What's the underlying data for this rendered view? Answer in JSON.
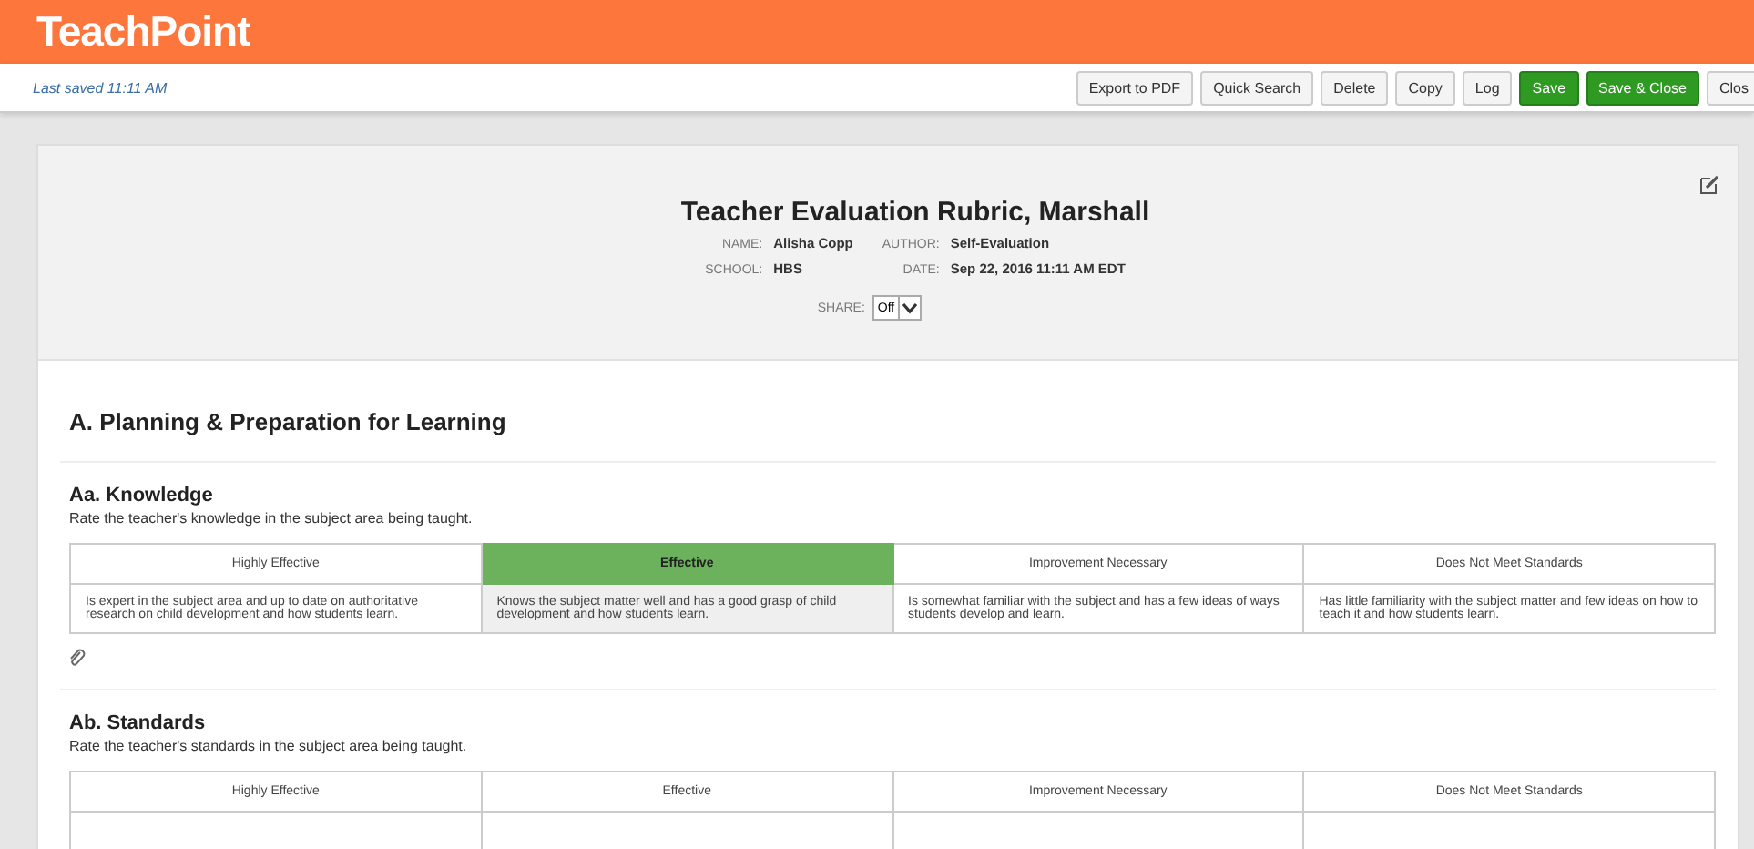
{
  "app": {
    "logo": "TeachPoint"
  },
  "toolbar": {
    "status": "Last saved 11:11 AM",
    "buttons": [
      {
        "label": "Export to PDF",
        "kind": "plain"
      },
      {
        "label": "Quick Search",
        "kind": "plain"
      },
      {
        "label": "Delete",
        "kind": "plain"
      },
      {
        "label": "Copy",
        "kind": "plain"
      },
      {
        "label": "Log",
        "kind": "plain"
      },
      {
        "label": "Save",
        "kind": "primary"
      },
      {
        "label": "Save & Close",
        "kind": "primary"
      },
      {
        "label": "Clos",
        "kind": "plain"
      }
    ]
  },
  "form": {
    "title": "Teacher Evaluation Rubric, Marshall",
    "fields": [
      {
        "label": "NAME:",
        "value": "Alisha Copp"
      },
      {
        "label": "AUTHOR:",
        "value": "Self-Evaluation"
      },
      {
        "label": "SCHOOL:",
        "value": "HBS"
      },
      {
        "label": "DATE:",
        "value": "Sep 22, 2016 11:11 AM EDT"
      }
    ],
    "share": {
      "label": "SHARE:",
      "value": "Off"
    }
  },
  "section": {
    "title": "A. Planning & Preparation for Learning",
    "criteria": [
      {
        "title": "Aa. Knowledge",
        "prompt": "Rate the teacher's knowledge in the subject area being taught.",
        "attachment": true,
        "levels": [
          {
            "label": "Highly Effective",
            "selected": false,
            "description": "Is expert in the subject area and up to date on authoritative research on child development and how students learn."
          },
          {
            "label": "Effective",
            "selected": true,
            "description": "Knows the subject matter well and has a good grasp of child development and how students learn."
          },
          {
            "label": "Improvement Necessary",
            "selected": false,
            "description": "Is somewhat familiar with the subject and has a few ideas of ways students develop and learn."
          },
          {
            "label": "Does Not Meet Standards",
            "selected": false,
            "description": "Has little familiarity with the subject matter and few ideas on how to teach it and how students learn."
          }
        ]
      },
      {
        "title": "Ab. Standards",
        "prompt": "Rate the teacher's standards in the subject area being taught.",
        "attachment": false,
        "levels": [
          {
            "label": "Highly Effective",
            "selected": false
          },
          {
            "label": "Effective",
            "selected": false
          },
          {
            "label": "Improvement Necessary",
            "selected": false
          },
          {
            "label": "Does Not Meet Standards",
            "selected": false
          }
        ]
      }
    ]
  }
}
